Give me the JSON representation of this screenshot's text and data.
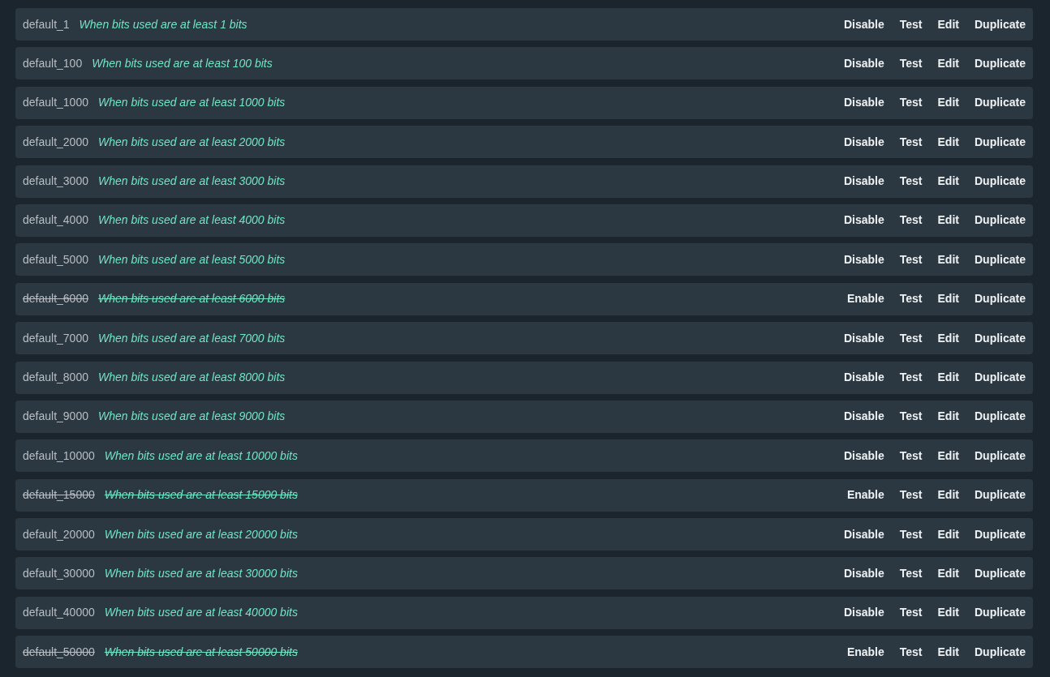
{
  "rules": [
    {
      "name": "default_1",
      "condition": "When bits used are at least 1 bits",
      "disabled": false,
      "actions": [
        "Disable",
        "Test",
        "Edit",
        "Duplicate"
      ]
    },
    {
      "name": "default_100",
      "condition": "When bits used are at least 100 bits",
      "disabled": false,
      "actions": [
        "Disable",
        "Test",
        "Edit",
        "Duplicate"
      ]
    },
    {
      "name": "default_1000",
      "condition": "When bits used are at least 1000 bits",
      "disabled": false,
      "actions": [
        "Disable",
        "Test",
        "Edit",
        "Duplicate"
      ]
    },
    {
      "name": "default_2000",
      "condition": "When bits used are at least 2000 bits",
      "disabled": false,
      "actions": [
        "Disable",
        "Test",
        "Edit",
        "Duplicate"
      ]
    },
    {
      "name": "default_3000",
      "condition": "When bits used are at least 3000 bits",
      "disabled": false,
      "actions": [
        "Disable",
        "Test",
        "Edit",
        "Duplicate"
      ]
    },
    {
      "name": "default_4000",
      "condition": "When bits used are at least 4000 bits",
      "disabled": false,
      "actions": [
        "Disable",
        "Test",
        "Edit",
        "Duplicate"
      ]
    },
    {
      "name": "default_5000",
      "condition": "When bits used are at least 5000 bits",
      "disabled": false,
      "actions": [
        "Disable",
        "Test",
        "Edit",
        "Duplicate"
      ]
    },
    {
      "name": "default_6000",
      "condition": "When bits used are at least 6000 bits",
      "disabled": true,
      "actions": [
        "Enable",
        "Test",
        "Edit",
        "Duplicate"
      ]
    },
    {
      "name": "default_7000",
      "condition": "When bits used are at least 7000 bits",
      "disabled": false,
      "actions": [
        "Disable",
        "Test",
        "Edit",
        "Duplicate"
      ]
    },
    {
      "name": "default_8000",
      "condition": "When bits used are at least 8000 bits",
      "disabled": false,
      "actions": [
        "Disable",
        "Test",
        "Edit",
        "Duplicate"
      ]
    },
    {
      "name": "default_9000",
      "condition": "When bits used are at least 9000 bits",
      "disabled": false,
      "actions": [
        "Disable",
        "Test",
        "Edit",
        "Duplicate"
      ]
    },
    {
      "name": "default_10000",
      "condition": "When bits used are at least 10000 bits",
      "disabled": false,
      "actions": [
        "Disable",
        "Test",
        "Edit",
        "Duplicate"
      ]
    },
    {
      "name": "default_15000",
      "condition": "When bits used are at least 15000 bits",
      "disabled": true,
      "actions": [
        "Enable",
        "Test",
        "Edit",
        "Duplicate"
      ]
    },
    {
      "name": "default_20000",
      "condition": "When bits used are at least 20000 bits",
      "disabled": false,
      "actions": [
        "Disable",
        "Test",
        "Edit",
        "Duplicate"
      ]
    },
    {
      "name": "default_30000",
      "condition": "When bits used are at least 30000 bits",
      "disabled": false,
      "actions": [
        "Disable",
        "Test",
        "Edit",
        "Duplicate"
      ]
    },
    {
      "name": "default_40000",
      "condition": "When bits used are at least 40000 bits",
      "disabled": false,
      "actions": [
        "Disable",
        "Test",
        "Edit",
        "Duplicate"
      ]
    },
    {
      "name": "default_50000",
      "condition": "When bits used are at least 50000 bits",
      "disabled": true,
      "actions": [
        "Enable",
        "Test",
        "Edit",
        "Duplicate"
      ]
    }
  ]
}
